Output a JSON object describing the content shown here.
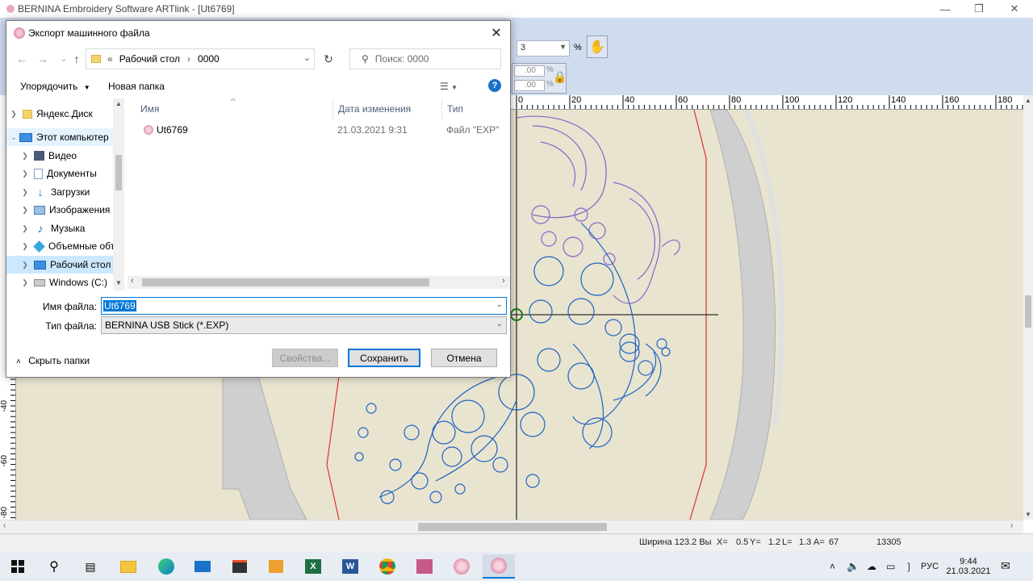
{
  "app": {
    "title": "BERNINA Embroidery Software ARTlink - [Ut6769]",
    "toolbar": {
      "zoom_suffix": "%",
      "field1_value": "3",
      "field2_value": ".00",
      "field3_value": ".00",
      "percent2": "%",
      "percent3": "%"
    },
    "ruler_top_labels": [
      "0",
      "20",
      "40",
      "60",
      "80",
      "100",
      "120",
      "140",
      "160",
      "180"
    ],
    "ruler_left_labels": [
      "-40",
      "-60",
      "-80"
    ],
    "status": {
      "width": "Ширина 123.2 Вы",
      "x": "X=",
      "x_val": "0.5",
      "y": "Y=",
      "y_val": "1.2",
      "l": "L=",
      "l_val": "1.3",
      "a": "A=",
      "a_val": "67",
      "stitches": "13305"
    }
  },
  "dialog": {
    "title": "Экспорт машинного файла",
    "address": {
      "prefix": "«",
      "crumbs": [
        "Рабочий стол",
        "0000"
      ],
      "sep": "›"
    },
    "search_placeholder": "Поиск: 0000",
    "commands": {
      "organize": "Упорядочить",
      "new_folder": "Новая папка"
    },
    "tree": [
      {
        "label": "Яндекс.Диск",
        "icon": "yandex-disk-icon",
        "indent": 1,
        "state": ""
      },
      {
        "label": "Этот компьютер",
        "icon": "computer-icon",
        "indent": 0,
        "state": "hover",
        "expanded": true
      },
      {
        "label": "Видео",
        "icon": "video-folder-icon",
        "indent": 1,
        "state": ""
      },
      {
        "label": "Документы",
        "icon": "documents-folder-icon",
        "indent": 1,
        "state": ""
      },
      {
        "label": "Загрузки",
        "icon": "downloads-folder-icon",
        "indent": 1,
        "state": ""
      },
      {
        "label": "Изображения",
        "icon": "pictures-folder-icon",
        "indent": 1,
        "state": ""
      },
      {
        "label": "Музыка",
        "icon": "music-folder-icon",
        "indent": 1,
        "state": ""
      },
      {
        "label": "Объемные объ",
        "icon": "3d-objects-folder-icon",
        "indent": 1,
        "state": ""
      },
      {
        "label": "Рабочий стол",
        "icon": "desktop-folder-icon",
        "indent": 1,
        "state": "selected"
      },
      {
        "label": "Windows (C:)",
        "icon": "drive-icon",
        "indent": 1,
        "state": ""
      }
    ],
    "columns": {
      "name": "Имя",
      "date": "Дата изменения",
      "type": "Тип"
    },
    "files": [
      {
        "name": "Ut6769",
        "date": "21.03.2021 9:31",
        "type": "Файл \"EXP\""
      }
    ],
    "filename_label": "Имя файла:",
    "filename_value": "Ut6769",
    "filetype_label": "Тип файла:",
    "filetype_value": "BERNINA USB Stick (*.EXP)",
    "hide_folders": "Скрыть папки",
    "buttons": {
      "properties": "Свойства...",
      "save": "Сохранить",
      "cancel": "Отмена"
    }
  },
  "taskbar": {
    "lang": "РУС",
    "time": "9:44",
    "date": "21.03.2021"
  }
}
